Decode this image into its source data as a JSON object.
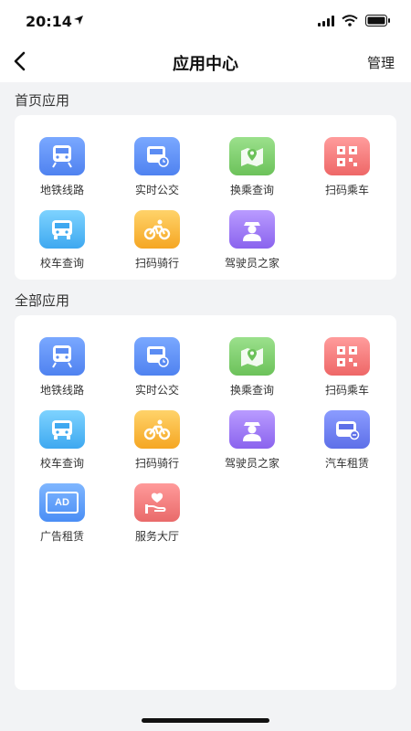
{
  "status_bar": {
    "time": "20:14"
  },
  "nav": {
    "title": "应用中心",
    "manage_label": "管理"
  },
  "sections": {
    "home": {
      "title": "首页应用",
      "apps": [
        {
          "label": "地铁线路",
          "icon": "metro-icon"
        },
        {
          "label": "实时公交",
          "icon": "bus-realtime-icon"
        },
        {
          "label": "换乘查询",
          "icon": "map-pin-icon"
        },
        {
          "label": "扫码乘车",
          "icon": "qr-code-icon"
        },
        {
          "label": "校车查询",
          "icon": "school-bus-icon"
        },
        {
          "label": "扫码骑行",
          "icon": "bike-icon"
        },
        {
          "label": "驾驶员之家",
          "icon": "driver-icon"
        }
      ]
    },
    "all": {
      "title": "全部应用",
      "apps": [
        {
          "label": "地铁线路",
          "icon": "metro-icon"
        },
        {
          "label": "实时公交",
          "icon": "bus-realtime-icon"
        },
        {
          "label": "换乘查询",
          "icon": "map-pin-icon"
        },
        {
          "label": "扫码乘车",
          "icon": "qr-code-icon"
        },
        {
          "label": "校车查询",
          "icon": "school-bus-icon"
        },
        {
          "label": "扫码骑行",
          "icon": "bike-icon"
        },
        {
          "label": "驾驶员之家",
          "icon": "driver-icon"
        },
        {
          "label": "汽车租赁",
          "icon": "car-rental-icon"
        },
        {
          "label": "广告租赁",
          "icon": "ad-icon",
          "icon_text": "AD"
        },
        {
          "label": "服务大厅",
          "icon": "service-hall-icon"
        }
      ]
    }
  }
}
